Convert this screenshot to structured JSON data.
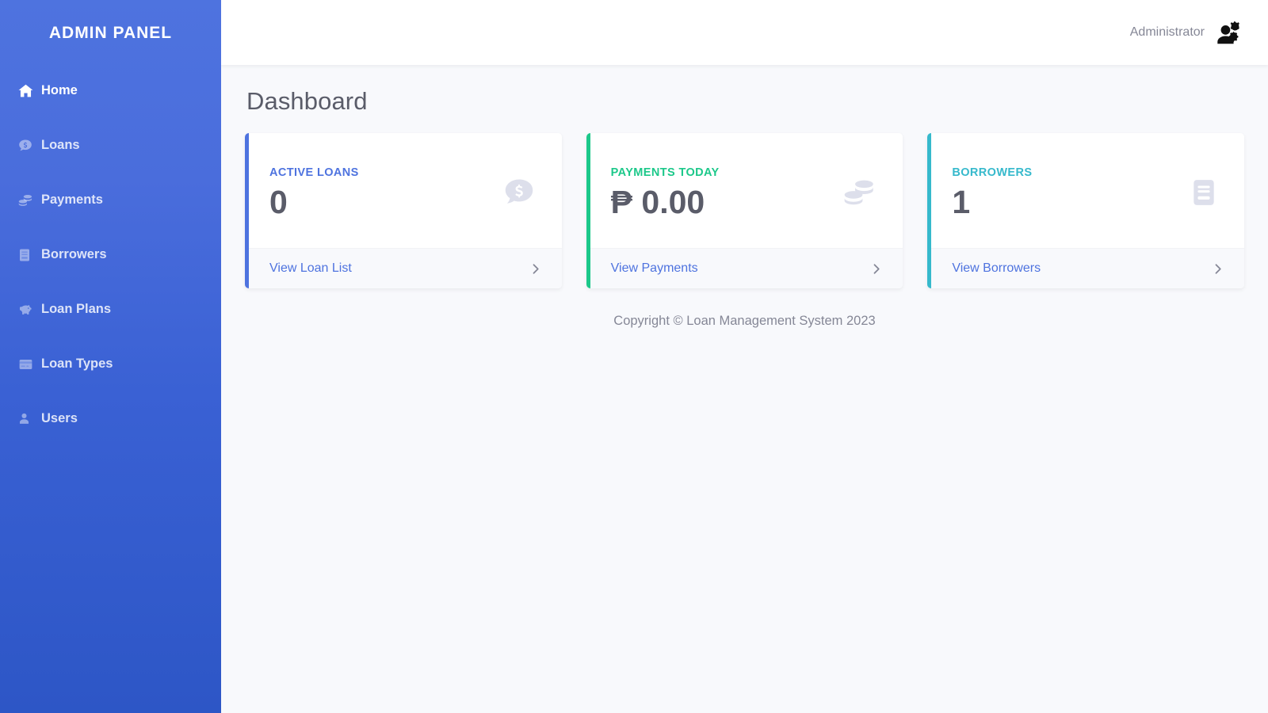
{
  "sidebar": {
    "brand": "ADMIN PANEL",
    "items": [
      {
        "label": "Home",
        "icon": "home-icon",
        "active": true
      },
      {
        "label": "Loans",
        "icon": "comment-dollar-icon",
        "active": false
      },
      {
        "label": "Payments",
        "icon": "coins-icon",
        "active": false
      },
      {
        "label": "Borrowers",
        "icon": "file-invoice-icon",
        "active": false
      },
      {
        "label": "Loan Plans",
        "icon": "piggy-bank-icon",
        "active": false
      },
      {
        "label": "Loan Types",
        "icon": "credit-card-icon",
        "active": false
      },
      {
        "label": "Users",
        "icon": "user-icon",
        "active": false
      }
    ]
  },
  "topbar": {
    "user_name": "Administrator",
    "avatar_icon": "users-cog-icon"
  },
  "page": {
    "title": "Dashboard",
    "copyright": "Copyright © Loan Management System 2023"
  },
  "cards": [
    {
      "label": "ACTIVE LOANS",
      "value": "0",
      "accent": "#4e73df",
      "label_color": "#4e73df",
      "icon": "comment-dollar-icon",
      "footer_label": "View Loan List",
      "footer_icon": "chevron-right-icon"
    },
    {
      "label": "PAYMENTS TODAY",
      "value": "₱ 0.00",
      "accent": "#1cc88a",
      "label_color": "#1cc88a",
      "icon": "coins-icon",
      "footer_label": "View Payments",
      "footer_icon": "chevron-right-icon"
    },
    {
      "label": "BORROWERS",
      "value": "1",
      "accent": "#36b9cc",
      "label_color": "#36b9cc",
      "icon": "file-invoice-icon",
      "footer_label": "View Borrowers",
      "footer_icon": "chevron-right-icon"
    }
  ]
}
